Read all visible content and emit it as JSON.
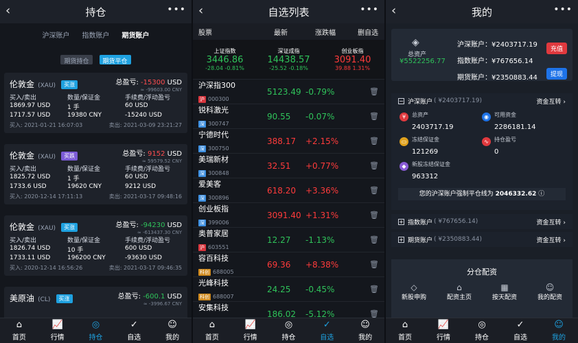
{
  "p1": {
    "title": "持仓",
    "tabs": [
      "沪深账户",
      "指数账户",
      "期货账户"
    ],
    "sub_tabs": [
      "期货持仓",
      "期货平仓"
    ],
    "field_labels": {
      "a": "买入/卖出",
      "b": "数量/保证金",
      "c": "手续费/浮动盈亏",
      "pnl": "总盈亏:",
      "buy": "买入:",
      "sell": "卖出:"
    },
    "positions": [
      {
        "name": "伦敦金",
        "code": "(XAU)",
        "dir": "买涨",
        "pnl": "-15300",
        "unit": "USD",
        "pnl_cny": "≈ -99603.00 CNY",
        "r1": [
          "1869.97 USD",
          "1 手",
          "60 USD"
        ],
        "r2": [
          "1717.57 USD",
          "19380 CNY",
          "-15240 USD"
        ],
        "buy": "2021-01-21 16:07:03",
        "sell": "2021-03-09 23:21:27"
      },
      {
        "name": "伦敦金",
        "code": "(XAU)",
        "dir": "买跌",
        "pnl": "9152",
        "unit": "USD",
        "pnl_cny": "≈ 59579.52 CNY",
        "r1": [
          "1825.72 USD",
          "1 手",
          "60 USD"
        ],
        "r2": [
          "1733.6 USD",
          "19620 CNY",
          "9212 USD"
        ],
        "buy": "2020-12-14 17:11:13",
        "sell": "2021-03-17 09:48:16"
      },
      {
        "name": "伦敦金",
        "code": "(XAU)",
        "dir": "买涨",
        "pnl": "-94230",
        "unit": "USD",
        "pnl_cny": "≈ -613437.30 CNY",
        "r1": [
          "1826.74 USD",
          "10 手",
          "600 USD"
        ],
        "r2": [
          "1733.11 USD",
          "196200 CNY",
          "-93630 USD"
        ],
        "buy": "2020-12-14 16:56:26",
        "sell": "2021-03-17 09:46:35"
      },
      {
        "name": "美原油",
        "code": "(CL)",
        "dir": "买涨",
        "pnl": "-600.1",
        "unit": "USD",
        "pnl_cny": "≈ -3996.67 CNY"
      }
    ]
  },
  "p2": {
    "title": "自选列表",
    "head": [
      "股票",
      "最新",
      "涨跌幅",
      "删自选"
    ],
    "indices": [
      {
        "name": "上证指数",
        "value": "3446.86",
        "change": "-28.04 -0.81%"
      },
      {
        "name": "深证成指",
        "value": "14438.57",
        "change": "-25.52 -0.18%"
      },
      {
        "name": "创业板指",
        "value": "3091.40",
        "change": "39.88 1.31%"
      }
    ],
    "rows": [
      {
        "name": "沪深指300",
        "mk": "沪",
        "code": "000300",
        "price": "5123.49",
        "chg": "-0.79%"
      },
      {
        "name": "锐科激光",
        "mk": "深",
        "code": "300747",
        "price": "90.55",
        "chg": "-0.07%"
      },
      {
        "name": "宁德时代",
        "mk": "深",
        "code": "300750",
        "price": "388.17",
        "chg": "+2.15%"
      },
      {
        "name": "美瑞新材",
        "mk": "深",
        "code": "300848",
        "price": "32.51",
        "chg": "+0.77%"
      },
      {
        "name": "爱美客",
        "mk": "深",
        "code": "300896",
        "price": "618.20",
        "chg": "+3.36%"
      },
      {
        "name": "创业板指",
        "mk": "深",
        "code": "399006",
        "price": "3091.40",
        "chg": "+1.31%"
      },
      {
        "name": "奥普家居",
        "mk": "沪",
        "code": "603551",
        "price": "12.27",
        "chg": "-1.13%"
      },
      {
        "name": "容百科技",
        "mk": "科创",
        "code": "688005",
        "price": "69.36",
        "chg": "+8.38%"
      },
      {
        "name": "光峰科技",
        "mk": "科创",
        "code": "688007",
        "price": "24.25",
        "chg": "-0.45%"
      },
      {
        "name": "安集科技",
        "mk": "科创",
        "code": "688019",
        "price": "186.02",
        "chg": "-5.12%"
      }
    ]
  },
  "p3": {
    "title": "我的",
    "assets_label": "总资产",
    "total": "¥5522256.77",
    "lines": [
      "沪深账户：¥2403717.19",
      "指数账户：¥767656.14",
      "期货账户：¥2350883.44"
    ],
    "recharge": "充值",
    "withdraw": "提现",
    "hs_account": "沪深账户",
    "hs_amount": "( ¥2403717.19)",
    "transfer": "资金互转",
    "metrics": [
      {
        "k": "总资产",
        "v": "2403717.19"
      },
      {
        "k": "可用资金",
        "v": "2286181.14"
      },
      {
        "k": "冻结保证金",
        "v": "121269"
      },
      {
        "k": "持仓盈亏",
        "v": "0"
      },
      {
        "k": "新股冻结保证金",
        "v": "963312"
      }
    ],
    "warn_text": "您的沪深账户强制平仓线为",
    "warn_value": "2046332.62",
    "idx_account": "指数账户",
    "idx_amount": "( ¥767656.14)",
    "fut_account": "期货账户",
    "fut_amount": "( ¥2350883.44)",
    "alloc_title": "分仓配资",
    "alloc_items": [
      "新股申购",
      "配资主页",
      "按天配资",
      "我的配资"
    ]
  },
  "nav": [
    "首页",
    "行情",
    "持仓",
    "自选",
    "我的"
  ]
}
